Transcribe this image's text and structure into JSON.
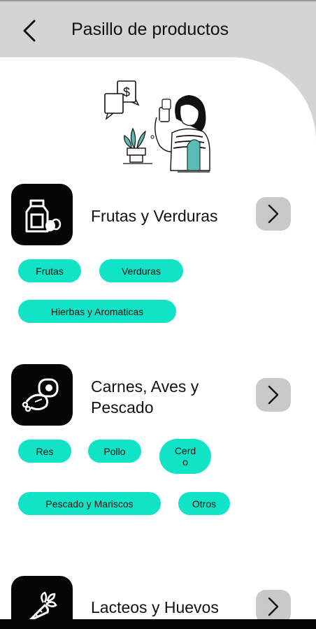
{
  "header": {
    "title": "Pasillo de productos"
  },
  "icons": {
    "back": "chevron-left-icon",
    "arrow": "chevron-right-icon"
  },
  "colors": {
    "chip": "#11e3c6",
    "accent_teal": "#5bbcb5",
    "icon_tile": "#050505",
    "arrow_button": "#c9c9c9"
  },
  "categories": [
    {
      "title": "Frutas y Verduras",
      "icon": "milk-eggs-icon",
      "chips": [
        "Frutas",
        "Verduras",
        "Hierbas y Aromaticas"
      ]
    },
    {
      "title_line1": "Carnes, Aves y",
      "title_line2": "Pescado",
      "icon": "meat-drumstick-icon",
      "chips": [
        "Res",
        "Pollo",
        "Cerd",
        "o",
        "Pescado y Mariscos",
        "Otros"
      ]
    },
    {
      "title": "Lacteos y Huevos",
      "icon": "carrot-icon"
    }
  ]
}
